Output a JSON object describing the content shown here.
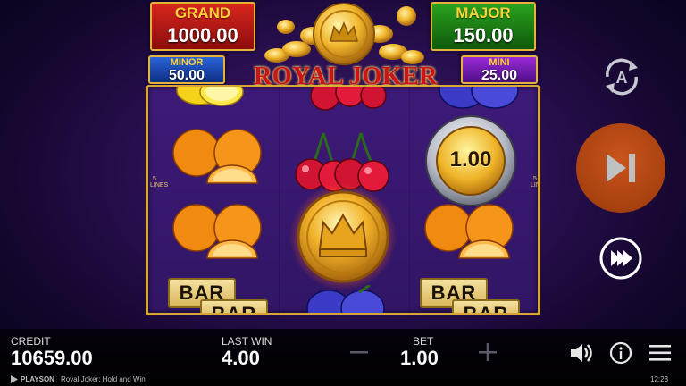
{
  "jackpots": {
    "grand": {
      "label": "GRAND",
      "value": "1000.00"
    },
    "major": {
      "label": "MAJOR",
      "value": "150.00"
    },
    "minor": {
      "label": "MINOR",
      "value": "50.00"
    },
    "mini": {
      "label": "MINI",
      "value": "25.00"
    }
  },
  "logo": {
    "text": "ROYAL JOKER"
  },
  "reels": {
    "lines_left": "5 LINES",
    "lines_right": "5 LINES",
    "coin_value": "1.00",
    "bar_label": "BAR",
    "symbols": [
      "lemon-icon",
      "cherry-icon",
      "plum-icon",
      "orange-icon",
      "crown-coin-icon",
      "silver-coin-icon",
      "bar-icon"
    ]
  },
  "controls": {
    "autoplay": "autoplay-icon",
    "spin": "spin-icon",
    "turbo": "turbo-icon"
  },
  "bottom": {
    "credit_label": "CREDIT",
    "credit_value": "10659.00",
    "last_win_label": "LAST WIN",
    "last_win_value": "4.00",
    "bet_label": "BET",
    "bet_value": "1.00",
    "minus": "−",
    "plus": "+"
  },
  "footer": {
    "brand": "PLAYSON",
    "game_title": "Royal Joker: Hold and Win",
    "clock": "12:23"
  },
  "colors": {
    "spin_button": "#a8410f",
    "frame_gold": "#d8a634",
    "grand_red": "#d8261d",
    "major_green": "#2aa21e",
    "minor_blue": "#2a63d8",
    "mini_purple": "#9a2ad8"
  }
}
